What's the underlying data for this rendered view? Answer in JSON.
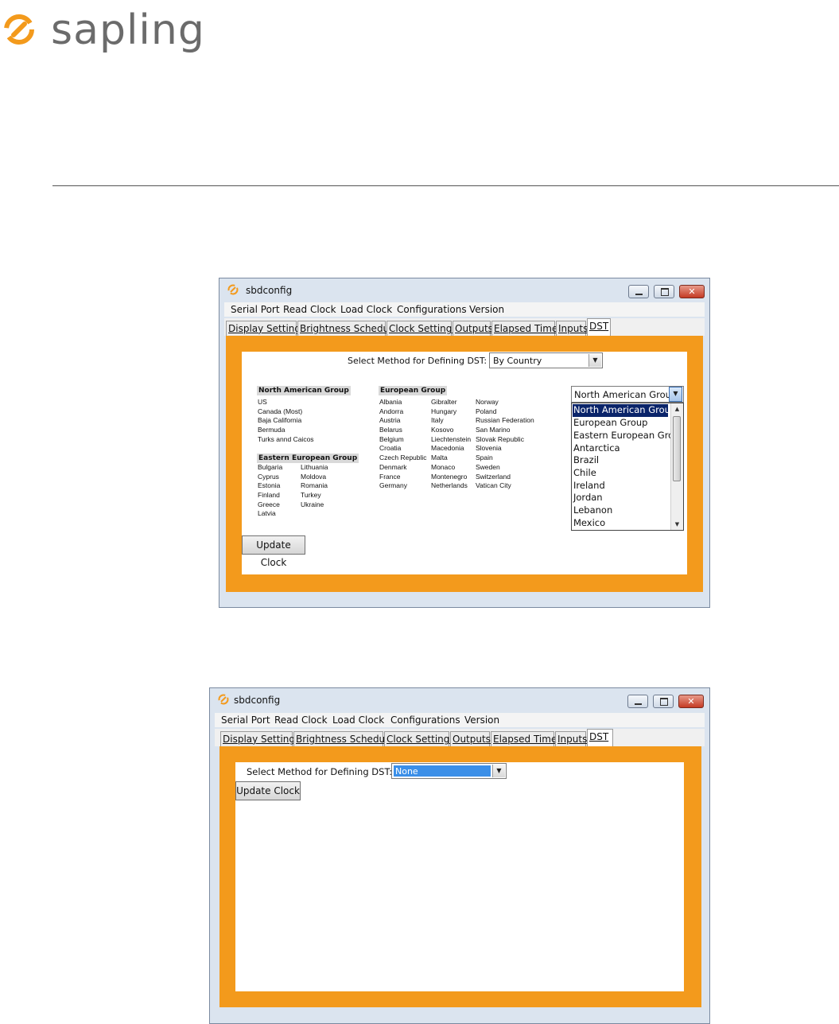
{
  "brand": {
    "name": "sapling",
    "accent": "#f39a1c"
  },
  "window1": {
    "title": "sbdconfig",
    "menu": [
      "Serial Port",
      "Read Clock",
      "Load Clock",
      "Configurations",
      "Version"
    ],
    "tabs": [
      "Display Settings",
      "Brightness Schedule",
      "Clock Settings",
      "Outputs",
      "Elapsed Timer",
      "Inputs",
      "DST"
    ],
    "active_tab": "DST",
    "method_label": "Select Method for Defining DST:",
    "method_value": "By Country",
    "groups": {
      "north_american": {
        "title": "North American Group",
        "countries": [
          "US",
          "Canada (Most)",
          "Baja California",
          "Bermuda",
          "Turks annd Caicos"
        ]
      },
      "eastern_european": {
        "title": "Eastern European Group",
        "col1": [
          "Bulgaria",
          "Cyprus",
          "Estonia",
          "Finland",
          "Greece",
          "Latvia"
        ],
        "col2": [
          "Lithuania",
          "Moldova",
          "Romania",
          "Turkey",
          "Ukraine"
        ]
      },
      "european": {
        "title": "European Group",
        "col1": [
          "Albania",
          "Andorra",
          "Austria",
          "Belarus",
          "Belgium",
          "Croatia",
          "Czech Republic",
          "Denmark",
          "France",
          "Germany"
        ],
        "col2": [
          "Gibralter",
          "Hungary",
          "Italy",
          "Kosovo",
          "Liechtenstein",
          "Macedonia",
          "Malta",
          "Monaco",
          "Montenegro",
          "Netherlands"
        ],
        "col3": [
          "Norway",
          "Poland",
          "Russian Federation",
          "San Marino",
          "Slovak Republic",
          "Slovenia",
          "Spain",
          "Sweden",
          "Switzerland",
          "Vatican City"
        ]
      }
    },
    "group_select_value": "North American Group",
    "group_options": [
      "North American Group",
      "European Group",
      "Eastern European Group",
      "Antarctica",
      "Brazil",
      "Chile",
      "Ireland",
      "Jordan",
      "Lebanon",
      "Mexico"
    ],
    "update_button": "Update Clock"
  },
  "window2": {
    "title": "sbdconfig",
    "menu": [
      "Serial Port",
      "Read Clock",
      "Load Clock",
      "Configurations",
      "Version"
    ],
    "tabs": [
      "Display Settings",
      "Brightness Schedule",
      "Clock Settings",
      "Outputs",
      "Elapsed Timer",
      "Inputs",
      "DST"
    ],
    "active_tab": "DST",
    "method_label": "Select Method for Defining DST:",
    "method_value": "None",
    "update_button": "Update Clock"
  }
}
